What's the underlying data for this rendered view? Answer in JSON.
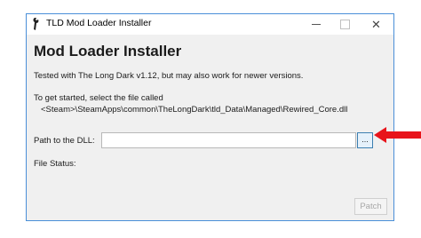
{
  "window": {
    "title": "TLD Mod Loader Installer",
    "app_icon": "wrench-icon"
  },
  "titlebar_buttons": {
    "minimize_icon": "minimize-icon",
    "maximize_icon": "maximize-icon",
    "close_icon": "close-icon",
    "close_glyph": "✕"
  },
  "main": {
    "heading": "Mod Loader Installer",
    "tested_text": "Tested with The Long Dark v1.12, but may also work for newer versions.",
    "instruction_text": "To get started, select the file called",
    "file_path_text": "<Steam>\\SteamApps\\common\\TheLongDark\\tld_Data\\Managed\\Rewired_Core.dll",
    "dll_label": "Path to the DLL:",
    "dll_value": "",
    "browse_label": "...",
    "file_status_label": "File Status:",
    "patch_label": "Patch"
  },
  "annotation": {
    "arrow_icon": "red-arrow-icon",
    "color": "#e8141b"
  }
}
